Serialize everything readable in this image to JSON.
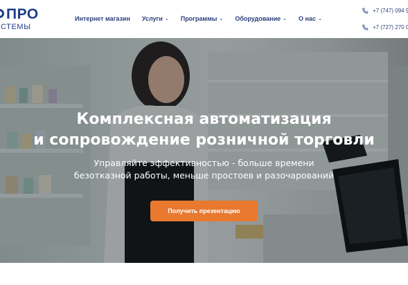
{
  "logo": {
    "top_text": "ПРО",
    "bottom_text": "СТЕМЫ"
  },
  "nav": {
    "items": [
      {
        "label": "Интернет магазин",
        "has_dropdown": false
      },
      {
        "label": "Услуги",
        "has_dropdown": true
      },
      {
        "label": "Программы",
        "has_dropdown": true
      },
      {
        "label": "Оборудование",
        "has_dropdown": true
      },
      {
        "label": "О нас",
        "has_dropdown": true
      }
    ]
  },
  "contacts": {
    "phones": [
      {
        "number": "+7 (747) 094 9",
        "icon": "phone-icon"
      },
      {
        "number": "+7 (727) 270 0",
        "icon": "phone-icon"
      }
    ]
  },
  "hero": {
    "title_line1": "Комплексная автоматизация",
    "title_line2": "и сопровождение розничной торговли",
    "subtitle_line1": "Управляйте эффективностью - больше времени",
    "subtitle_line2": "безотказной работы, меньше простоев и разочарований",
    "cta_label": "Получить презентацию"
  },
  "colors": {
    "brand": "#1f3d8c",
    "nav_text": "#2b3f7a",
    "cta": "#e8792f"
  }
}
